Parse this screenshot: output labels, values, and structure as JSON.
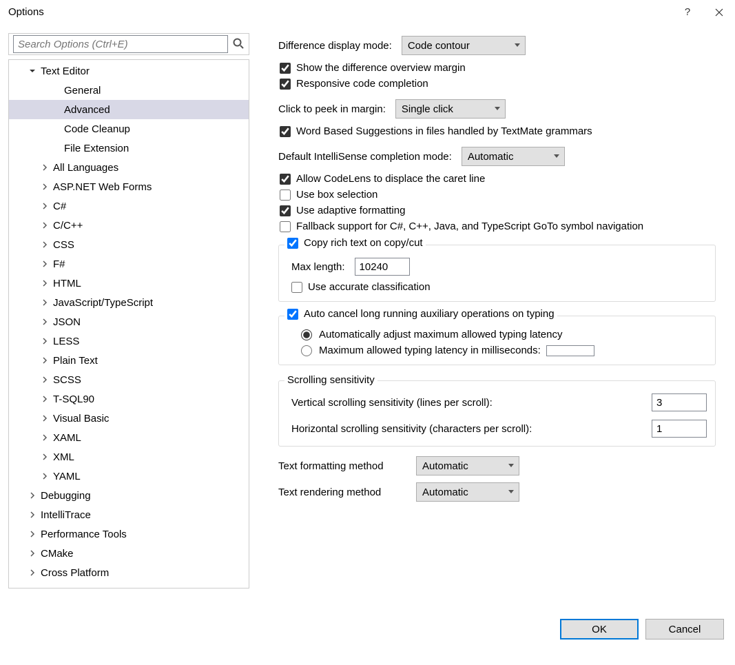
{
  "window": {
    "title": "Options"
  },
  "search": {
    "placeholder": "Search Options (Ctrl+E)"
  },
  "tree": {
    "root": "Text Editor",
    "children_simple": [
      "General",
      "Advanced",
      "Code Cleanup",
      "File Extension"
    ],
    "children_exp": [
      "All Languages",
      "ASP.NET Web Forms",
      "C#",
      "C/C++",
      "CSS",
      "F#",
      "HTML",
      "JavaScript/TypeScript",
      "JSON",
      "LESS",
      "Plain Text",
      "SCSS",
      "T-SQL90",
      "Visual Basic",
      "XAML",
      "XML",
      "YAML"
    ],
    "siblings": [
      "Debugging",
      "IntelliTrace",
      "Performance Tools",
      "CMake",
      "Cross Platform"
    ]
  },
  "right": {
    "diffmode_label": "Difference display mode:",
    "diffmode_value": "Code contour",
    "chk_overview": "Show the difference overview margin",
    "chk_responsive": "Responsive code completion",
    "peek_label": "Click to peek in margin:",
    "peek_value": "Single click",
    "chk_wordbased": "Word Based Suggestions in files handled by TextMate grammars",
    "intelli_label": "Default IntelliSense completion mode:",
    "intelli_value": "Automatic",
    "chk_codelens": "Allow CodeLens to displace the caret line",
    "chk_box": "Use box selection",
    "chk_adaptive": "Use adaptive formatting",
    "chk_fallback": "Fallback support for C#, C++, Java, and TypeScript GoTo symbol navigation",
    "group_copy_title": "Copy rich text on copy/cut",
    "maxlen_label": "Max length:",
    "maxlen_value": "10240",
    "chk_accurate": "Use accurate classification",
    "group_auto_title": "Auto cancel long running auxiliary operations on typing",
    "radio_auto": "Automatically adjust maximum allowed typing latency",
    "radio_manual": "Maximum allowed typing latency in milliseconds:",
    "group_scroll_title": "Scrolling sensitivity",
    "vscroll_label": "Vertical scrolling sensitivity (lines per scroll):",
    "vscroll_value": "3",
    "hscroll_label": "Horizontal scrolling sensitivity (characters per scroll):",
    "hscroll_value": "1",
    "fmt_label": "Text formatting method",
    "fmt_value": "Automatic",
    "render_label": "Text rendering method",
    "render_value": "Automatic"
  },
  "buttons": {
    "ok": "OK",
    "cancel": "Cancel"
  }
}
